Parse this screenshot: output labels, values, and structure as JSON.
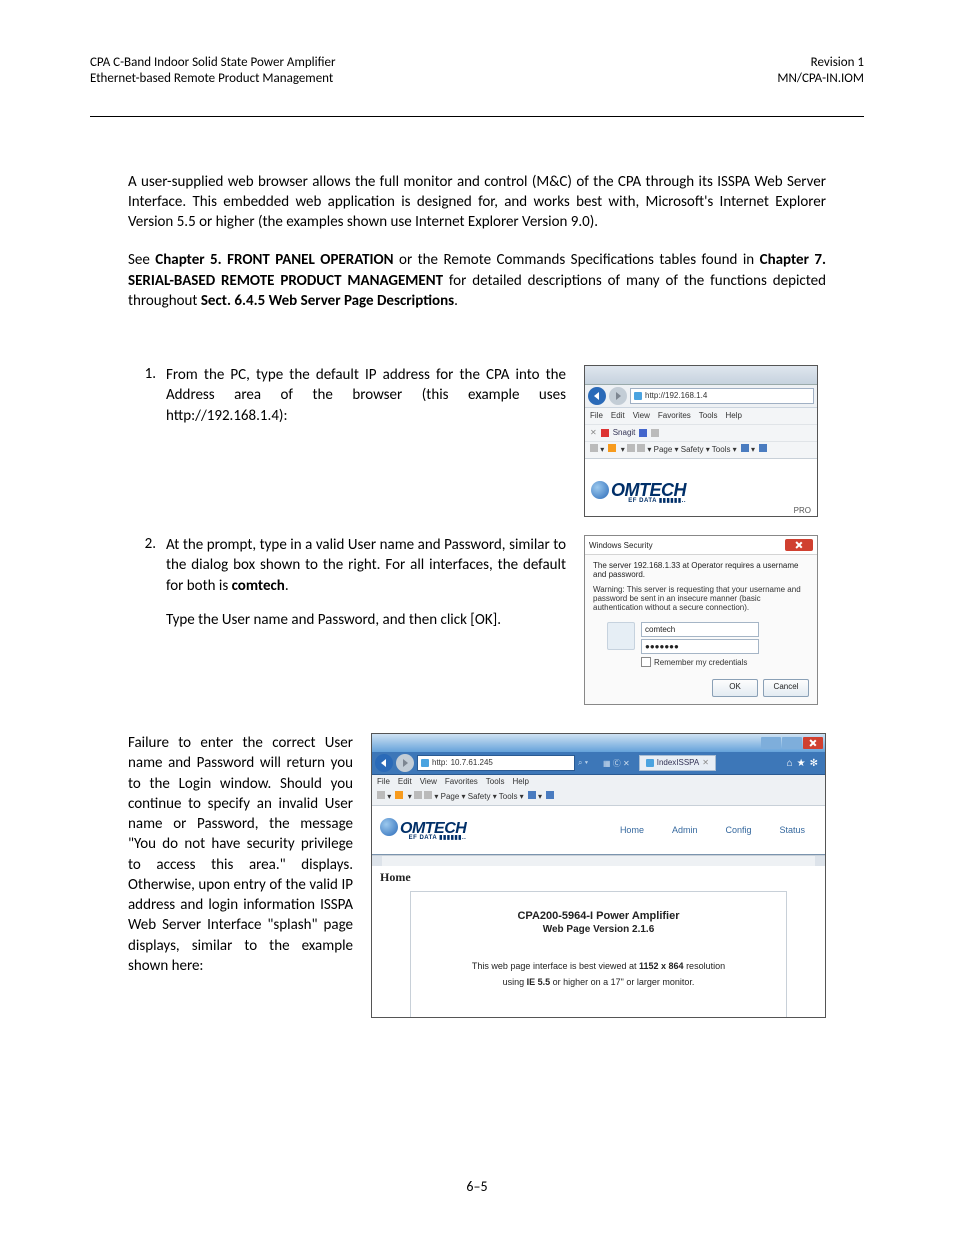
{
  "header": {
    "left1": "CPA C-Band Indoor Solid State Power Amplifier",
    "left2": "Ethernet-based Remote Product Management",
    "right1": "Revision 1",
    "right2": "MN/CPA-IN.IOM"
  },
  "para1_a": "A user-supplied web browser allows the full monitor and control (M&C) of the CPA through its ISSPA Web Server Interface. This embedded web application is designed for, and works best with, Microsoft's Internet Explorer Version 5.5 or higher (the examples shown use Internet Explorer Version 9.0).",
  "para2_a": "See ",
  "para2_b": "Chapter 5. FRONT PANEL OPERATION",
  "para2_c": " or the Remote Commands Specifications tables found in ",
  "para2_d": "Chapter 7. SERIAL-BASED REMOTE PRODUCT MANAGEMENT",
  "para2_e": " for detailed descriptions of many of the functions depicted throughout ",
  "para2_f": "Sect. 6.4.5 Web Server Page Descriptions",
  "para2_g": ".",
  "step1_num": "1.",
  "step1_txt": "From the PC, type the default IP address for the CPA into the Address area of the browser (this example uses http://192.168.1.4):",
  "step2_num": "2.",
  "step2_a": "At the prompt, type in a valid User name and Password, similar to the dialog box shown to the right. For all interfaces, the default for both is ",
  "step2_b": "comtech",
  "step2_c": ".",
  "step2_d": "Type the User name and Password, and then click [OK].",
  "para3": "Failure to enter the correct User name and Password will return you to the Login window. Should you continue to specify an invalid User name or Password, the message \"You do not have security privilege to access this area.\" displays. Otherwise, upon entry of the valid IP address and login information ISSPA Web Server Interface \"splash\" page displays, similar to the example shown here:",
  "fig1": {
    "url": "http://192.168.1.4",
    "menu": {
      "file": "File",
      "edit": "Edit",
      "view": "View",
      "fav": "Favorites",
      "tools": "Tools",
      "help": "Help"
    },
    "snagit": "Snagit",
    "row4": "Page ▾   Safety ▾   Tools ▾",
    "logo": "OMTECH",
    "sub": "EF DATA ▮▮▮▮▮▮..",
    "pro": "PRO"
  },
  "fig2": {
    "title": "Windows Security",
    "line1": "The server 192.168.1.33 at Operator requires a username and password.",
    "warn": "Warning: This server is requesting that your username and password be sent in an insecure manner (basic authentication without a secure connection).",
    "user": "comtech",
    "pass": "●●●●●●●",
    "remember": "Remember my credentials",
    "ok": "OK",
    "cancel": "Cancel"
  },
  "fig3": {
    "url_prefix": "http:",
    "url_ip": "  10.7.61.245",
    "search_hint": "⌕ ▾",
    "tab": "IndexISSPA",
    "menu": {
      "file": "File",
      "edit": "Edit",
      "view": "View",
      "fav": "Favorites",
      "tools": "Tools",
      "help": "Help"
    },
    "toolrow": "Page ▾   Safety ▾   Tools ▾",
    "logo": "OMTECH",
    "sub": "EF DATA ▮▮▮▮▮▮..",
    "nav": {
      "home": "Home",
      "admin": "Admin",
      "config": "Config",
      "status": "Status"
    },
    "home_h": "Home",
    "model": "CPA200-5964-I Power Amplifier",
    "ver": "Web Page Version 2.1.6",
    "info1_a": "This web page interface is best viewed at ",
    "info1_b": "1152 x 864",
    "info1_c": " resolution",
    "info2_a": "using ",
    "info2_b": "IE 5.5",
    "info2_c": " or higher on a 17\" or larger monitor."
  },
  "footer": "6–5"
}
